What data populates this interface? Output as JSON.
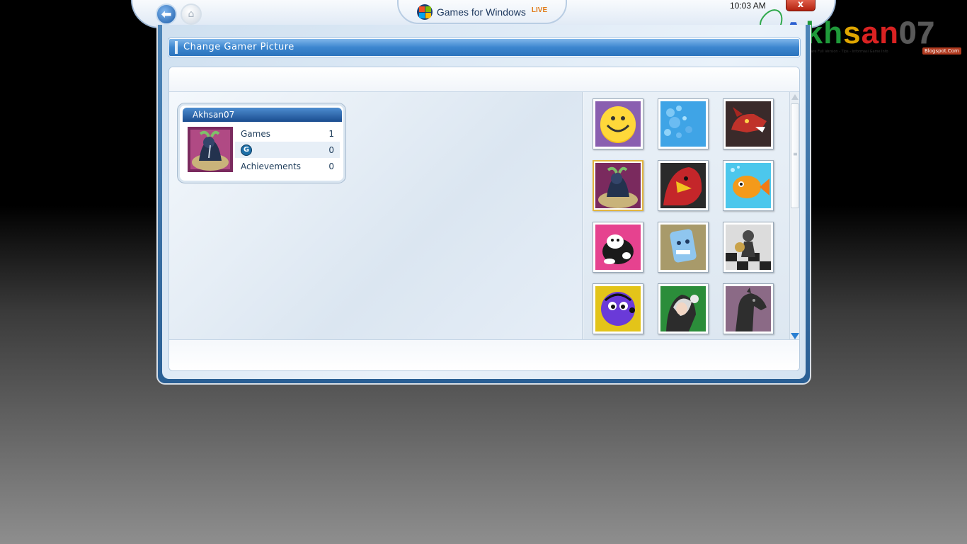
{
  "header": {
    "brand_text": "Games for Windows",
    "brand_live": "LIVE",
    "clock": "10:03 AM",
    "close_label": "x"
  },
  "watermark": {
    "parts": [
      "A",
      "k",
      "h",
      "s",
      "an",
      "07"
    ],
    "sub": "Download Software Full Version - Tips - Informasi Game Info",
    "badge": "Blogspot.Com"
  },
  "page_title": "Change Gamer Picture",
  "gamer_card": {
    "gamertag": "Akhsan07",
    "stats": [
      {
        "label": "Games",
        "value": "1"
      },
      {
        "label": "G",
        "value": "0",
        "is_icon": true
      },
      {
        "label": "Achievements",
        "value": "0"
      }
    ]
  },
  "pictures": [
    {
      "name": "smiley",
      "icon": "smiley-face-icon",
      "bg": "#8a5fb0"
    },
    {
      "name": "bubbles",
      "icon": "blue-bubbles-icon",
      "bg": "#3fa4e6"
    },
    {
      "name": "dragon",
      "icon": "red-dragon-icon",
      "bg": "#3a2a2a"
    },
    {
      "name": "elephant-knight",
      "icon": "elephant-knight-icon",
      "bg": "#7a2a5e",
      "selected": true
    },
    {
      "name": "red-bird",
      "icon": "red-bird-icon",
      "bg": "#c4262a"
    },
    {
      "name": "goldfish",
      "icon": "goldfish-icon",
      "bg": "#4cc7ec"
    },
    {
      "name": "cow",
      "icon": "black-cow-icon",
      "bg": "#e6428f"
    },
    {
      "name": "blue-robot",
      "icon": "blue-robot-icon",
      "bg": "#a89a6a"
    },
    {
      "name": "chess-pawn",
      "icon": "chess-pawn-icon",
      "bg": "#2a2a2a"
    },
    {
      "name": "purple-gear",
      "icon": "purple-gear-monster-icon",
      "bg": "#e3c419"
    },
    {
      "name": "anime-girl",
      "icon": "anime-girl-icon",
      "bg": "#2b8d3a"
    },
    {
      "name": "horse",
      "icon": "horse-head-icon",
      "bg": "#8b6a86"
    }
  ],
  "colors": {
    "accent": "#3c86cf",
    "selection": "#e2b640",
    "close": "#c9381f"
  }
}
